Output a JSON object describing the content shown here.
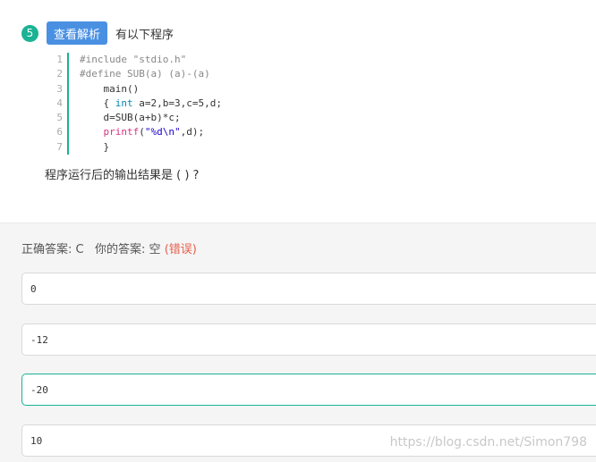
{
  "question": {
    "number": "5",
    "view_button": "查看解析",
    "title": "有以下程序",
    "prompt": "程序运行后的输出结果是 ( ) ?"
  },
  "code": {
    "line_numbers": [
      "1",
      "2",
      "3",
      "4",
      "5",
      "6",
      "7"
    ],
    "line1": "#include \"stdio.h\"",
    "line2": "#define SUB(a) (a)-(a)",
    "line3": "    main()",
    "line4_indent": "    { ",
    "line4_kw": "int",
    "line4_rest": " a=2,b=3,c=5,d;",
    "line5": "    d=SUB(a+b)*c;",
    "line6_indent": "    ",
    "line6_fn": "printf",
    "line6_open": "(",
    "line6_str": "\"%d\\n\"",
    "line6_rest": ",d);",
    "line7": "    }"
  },
  "answer": {
    "correct_label": "正确答案:",
    "correct_value": "C",
    "your_label": "你的答案:",
    "your_value": "空",
    "status": "(错误)"
  },
  "options": [
    "0",
    "-12",
    "-20",
    "10"
  ],
  "watermark": "https://blog.csdn.net/Simon798",
  "colors": {
    "accent_green": "#1ab394",
    "button_blue": "#4a90e2",
    "wrong_red": "#e8604c"
  }
}
